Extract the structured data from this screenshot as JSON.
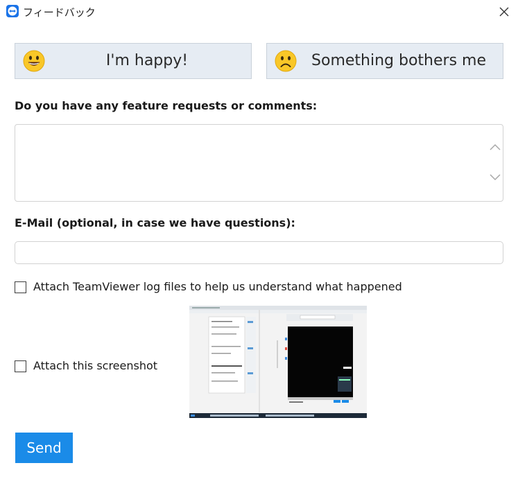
{
  "window": {
    "title": "フィードバック",
    "icon": "teamviewer-logo-icon",
    "close_icon": "close-icon"
  },
  "mood": {
    "happy_label": "I'm happy!",
    "happy_icon": "smiley-face-icon",
    "sad_label": "Something bothers me",
    "sad_icon": "frowning-face-icon"
  },
  "comments": {
    "label": "Do you have any feature requests or comments:",
    "value": "",
    "scroll_up_icon": "chevron-up-icon",
    "scroll_down_icon": "chevron-down-icon"
  },
  "email": {
    "label": "E-Mail (optional, in case we have questions):",
    "value": ""
  },
  "attachments": {
    "log_label": "Attach TeamViewer log files to help us understand what happened",
    "log_checked": false,
    "screenshot_label": "Attach this screenshot",
    "screenshot_checked": false,
    "thumbnail": "screenshot-thumbnail"
  },
  "actions": {
    "send_label": "Send"
  },
  "colors": {
    "accent": "#1a8be8",
    "mood_button_bg": "#e6ecf3",
    "emoji_yellow": "#f9c728"
  }
}
